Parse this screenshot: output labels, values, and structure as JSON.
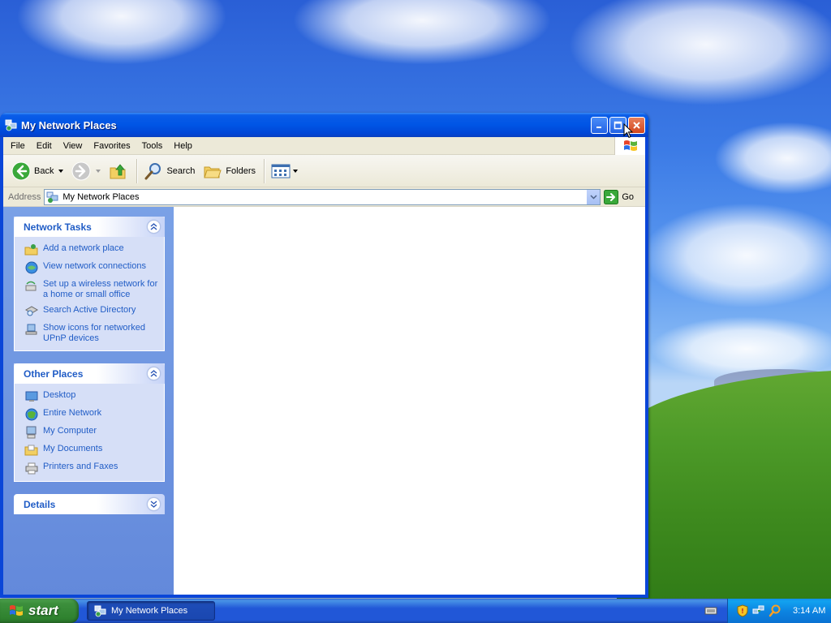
{
  "window": {
    "title": "My Network Places"
  },
  "menubar": {
    "items": [
      "File",
      "Edit",
      "View",
      "Favorites",
      "Tools",
      "Help"
    ]
  },
  "toolbar": {
    "back_label": "Back",
    "search_label": "Search",
    "folders_label": "Folders"
  },
  "address": {
    "label": "Address",
    "value": "My Network Places",
    "go_label": "Go"
  },
  "panels": {
    "network_tasks": {
      "title": "Network Tasks",
      "items": [
        "Add a network place",
        "View network connections",
        "Set up a wireless network for a home or small office",
        "Search Active Directory",
        "Show icons for networked UPnP devices"
      ]
    },
    "other_places": {
      "title": "Other Places",
      "items": [
        "Desktop",
        "Entire Network",
        "My Computer",
        "My Documents",
        "Printers and Faxes"
      ]
    },
    "details": {
      "title": "Details"
    }
  },
  "taskbar": {
    "start_label": "start",
    "task_label": "My Network Places",
    "clock": "3:14 AM"
  },
  "colors": {
    "titlebar": "#0055e5",
    "task_link": "#215dc6",
    "taskpane": "#7aa1e6",
    "start_green": "#3c8f3c",
    "taskbar_blue": "#2157d7"
  }
}
